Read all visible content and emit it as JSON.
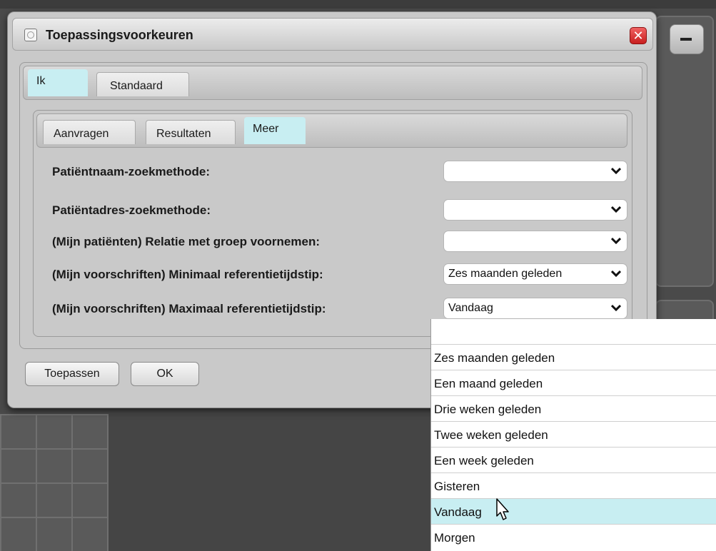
{
  "dialog": {
    "title": "Toepassingsvoorkeuren",
    "close_symbol": "✕",
    "icon": "app-icon"
  },
  "outer_tabs": [
    {
      "label": "Ik",
      "active": true
    },
    {
      "label": "Standaard",
      "active": false
    }
  ],
  "inner_tabs": [
    {
      "label": "Aanvragen",
      "active": false
    },
    {
      "label": "Resultaten",
      "active": false
    },
    {
      "label": "Meer",
      "active": true
    }
  ],
  "fields": [
    {
      "label": "Patiëntnaam-zoekmethode:",
      "value": ""
    },
    {
      "label": "Patiëntadres-zoekmethode:",
      "value": ""
    },
    {
      "label": "(Mijn patiënten) Relatie met groep voornemen:",
      "value": ""
    },
    {
      "label": "(Mijn voorschriften) Minimaal referentietijdstip:",
      "value": "Zes maanden geleden"
    },
    {
      "label": "(Mijn voorschriften) Maximaal referentietijdstip:",
      "value": "Vandaag"
    }
  ],
  "buttons": {
    "apply": "Toepassen",
    "ok": "OK"
  },
  "dropdown": {
    "options": [
      "",
      "Zes maanden geleden",
      "Een maand geleden",
      "Drie weken geleden",
      "Twee weken geleden",
      "Een week geleden",
      "Gisteren",
      "Vandaag",
      "Morgen"
    ],
    "highlighted": "Vandaag"
  },
  "colors": {
    "active_tab": "#c8eef2",
    "highlight": "#c8eef2",
    "close": "#d42f2f"
  }
}
